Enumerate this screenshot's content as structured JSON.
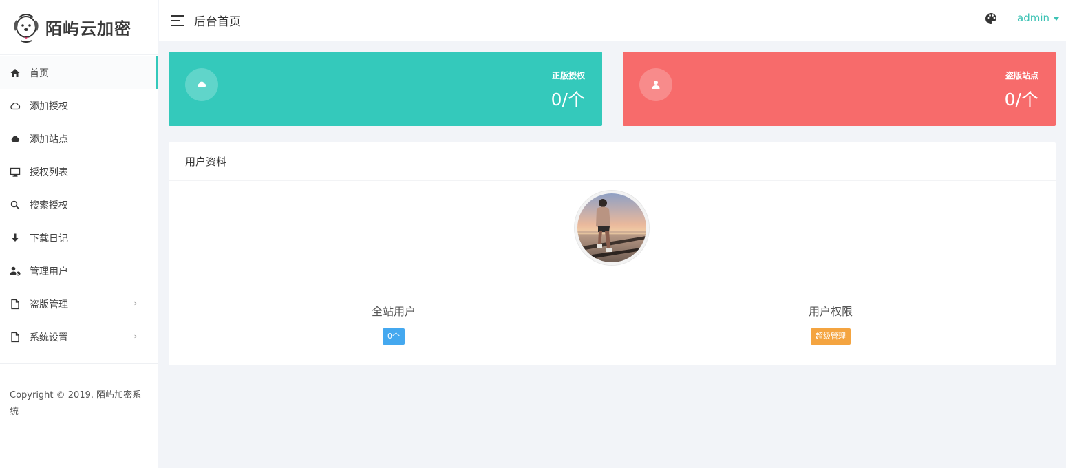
{
  "brand": {
    "name": "陌屿云加密"
  },
  "sidebar": {
    "items": [
      {
        "label": "首页",
        "icon": "home-icon",
        "active": true,
        "has_submenu": false
      },
      {
        "label": "添加授权",
        "icon": "cloud-outline-icon",
        "active": false,
        "has_submenu": false
      },
      {
        "label": "添加站点",
        "icon": "cloud-icon",
        "active": false,
        "has_submenu": false
      },
      {
        "label": "授权列表",
        "icon": "monitor-icon",
        "active": false,
        "has_submenu": false
      },
      {
        "label": "搜索授权",
        "icon": "search-icon",
        "active": false,
        "has_submenu": false
      },
      {
        "label": "下载日记",
        "icon": "download-icon",
        "active": false,
        "has_submenu": false
      },
      {
        "label": "管理用户",
        "icon": "user-gear-icon",
        "active": false,
        "has_submenu": false
      },
      {
        "label": "盗版管理",
        "icon": "document-icon",
        "active": false,
        "has_submenu": true
      },
      {
        "label": "系统设置",
        "icon": "document-icon",
        "active": false,
        "has_submenu": true
      }
    ],
    "submenu_arrow": "›",
    "copyright": "Copyright © 2019. 陌屿加密系统"
  },
  "header": {
    "title": "后台首页",
    "user": "admin",
    "theme_icon": "palette-icon"
  },
  "stats": [
    {
      "label": "正版授权",
      "value": "0/个",
      "icon": "cloud-icon",
      "color": "#34c9bb"
    },
    {
      "label": "盗版站点",
      "value": "0/个",
      "icon": "user-icon",
      "color": "#f76b6b"
    }
  ],
  "profile": {
    "title": "用户资料",
    "site_users_label": "全站用户",
    "site_users_value": "0个",
    "permission_label": "用户权限",
    "permission_value": "超级管理"
  },
  "colors": {
    "accent": "#34c9bb",
    "danger": "#f76b6b",
    "badge_blue": "#44a8ef",
    "badge_orange": "#f4a440"
  }
}
